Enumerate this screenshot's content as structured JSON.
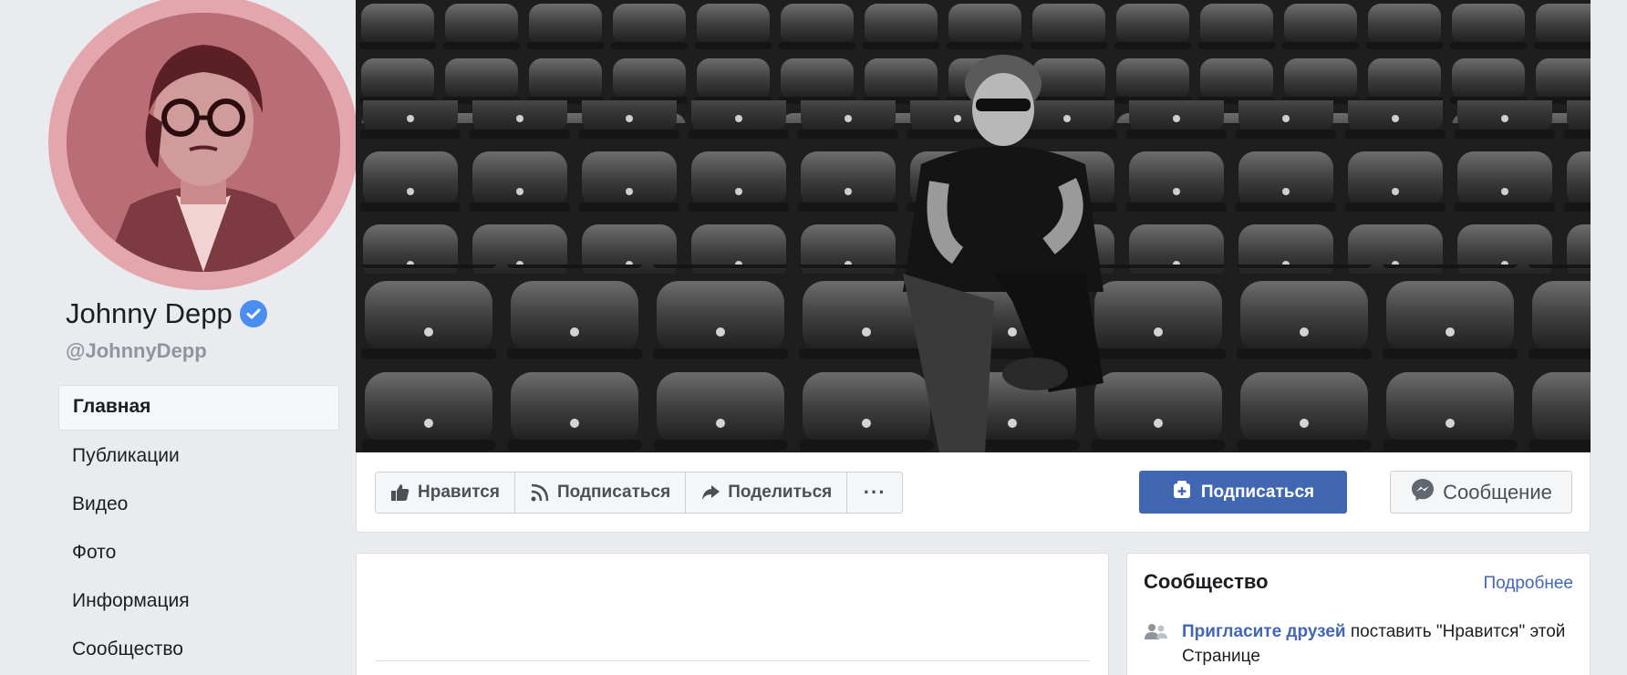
{
  "profile": {
    "name": "Johnny Depp",
    "username": "@JohnnyDepp"
  },
  "nav": {
    "items": [
      {
        "label": "Главная",
        "active": true
      },
      {
        "label": "Публикации"
      },
      {
        "label": "Видео"
      },
      {
        "label": "Фото"
      },
      {
        "label": "Информация"
      },
      {
        "label": "Сообщество"
      }
    ]
  },
  "actions": {
    "like_label": "Нравится",
    "follow_label": "Подписаться",
    "share_label": "Поделиться",
    "more_label": "···",
    "primary_follow_label": "Подписаться",
    "message_label": "Сообщение"
  },
  "community": {
    "title": "Сообщество",
    "more_link": "Подробнее",
    "invite_link": "Пригласите друзей",
    "invite_text": " поставить \"Нравится\" этой Странице"
  },
  "colors": {
    "brand_blue": "#4267b2",
    "avatar_ring": "#e3a6ad",
    "page_bg": "#e9ebee"
  },
  "icons": [
    "verified-badge-icon",
    "thumbs-up-icon",
    "rss-icon",
    "share-arrow-icon",
    "more-dots-icon",
    "follow-plus-icon",
    "messenger-icon",
    "invite-friends-icon"
  ]
}
